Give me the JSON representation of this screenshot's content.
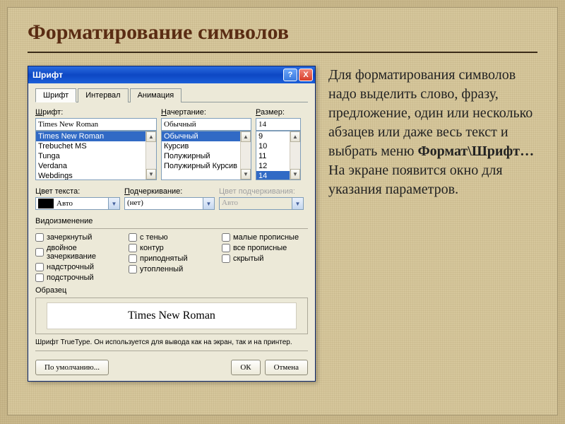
{
  "slide": {
    "title": "Форматирование символов",
    "paragraph_lead": "Для форматирования символов надо выделить слово, фразу, предложение, один или несколько абзацев или даже весь текст и выбрать меню ",
    "paragraph_bold": "Формат\\Шрифт…",
    "paragraph_tail": " На экране появится окно для указания параметров."
  },
  "dialog": {
    "title": "Шрифт",
    "help_glyph": "?",
    "close_glyph": "X",
    "tabs": {
      "font": "Шрифт",
      "interval": "Интервал",
      "anim": "Анимация"
    },
    "font_label_u": "Ш",
    "font_label_rest": "рифт:",
    "font_value": "Times New Roman",
    "font_list": [
      "Times New Roman",
      "Trebuchet MS",
      "Tunga",
      "Verdana",
      "Webdings"
    ],
    "style_label_u": "Н",
    "style_label_rest": "ачертание:",
    "style_value": "Обычный",
    "style_list": [
      "Обычный",
      "Курсив",
      "Полужирный",
      "Полужирный Курсив"
    ],
    "size_label_u": "Р",
    "size_label_rest": "азмер:",
    "size_value": "14",
    "size_list": [
      "9",
      "10",
      "11",
      "12",
      "14"
    ],
    "color_label": "Цвет текста:",
    "color_value": "Авто",
    "underline_label_u": "П",
    "underline_label_rest": "одчеркивание:",
    "underline_value": "(нет)",
    "underline_color_label": "Цвет подчеркивания:",
    "underline_color_value": "Авто",
    "effects_label": "Видоизменение",
    "checks_col1": [
      {
        "u": "з",
        "rest": "ачеркнутый"
      },
      {
        "u": "д",
        "rest": "войное зачеркивание"
      },
      {
        "u": "н",
        "rest": "адстрочный"
      },
      {
        "u": "п",
        "rest": "одстрочный"
      }
    ],
    "checks_col2": [
      {
        "u": "с",
        "rest": " тенью"
      },
      {
        "u": "к",
        "rest": "онтур"
      },
      {
        "u": "п",
        "rest": "риподнятый"
      },
      {
        "u": "у",
        "rest": "топленный"
      }
    ],
    "checks_col3": [
      {
        "u": "м",
        "rest": "алые прописные"
      },
      {
        "u": "в",
        "rest": "се прописные"
      },
      {
        "u": "с",
        "rest": "крытый"
      }
    ],
    "preview_label": "Образец",
    "preview_text": "Times New Roman",
    "hint": "Шрифт TrueType. Он используется для вывода как на экран, так и на принтер.",
    "btn_default": "По умолчанию...",
    "btn_ok": "ОК",
    "btn_cancel": "Отмена"
  }
}
